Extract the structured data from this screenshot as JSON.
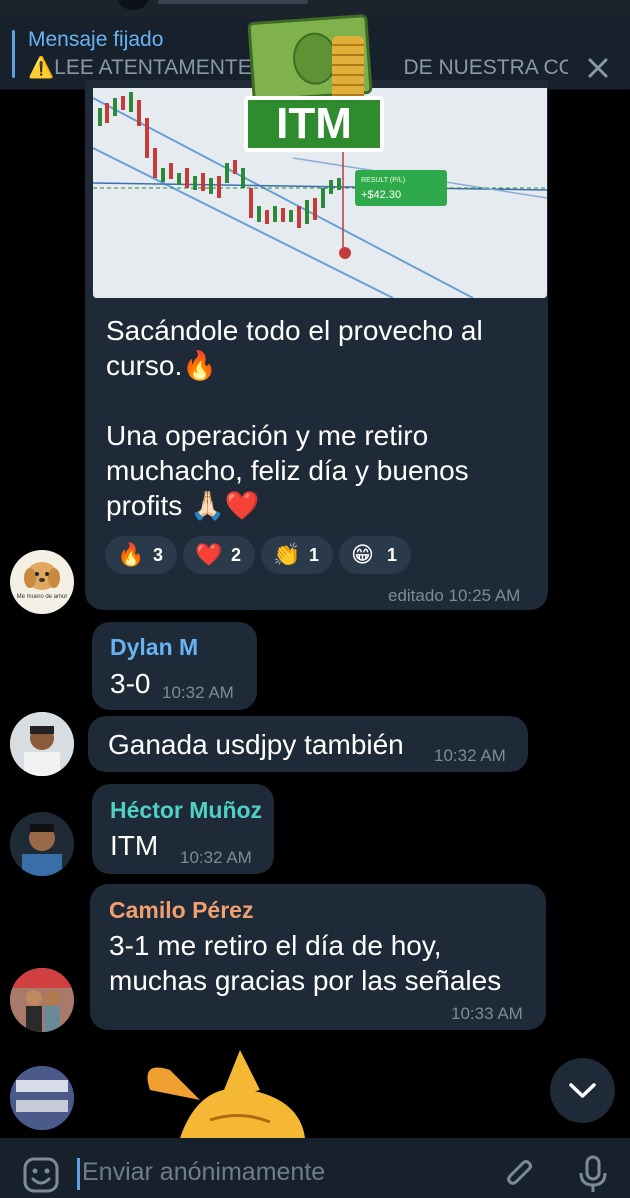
{
  "pinned": {
    "title": "Mensaje fijado",
    "text": "⚠️LEE ATENTAMENTE",
    "text_tail": "DE NUESTRA CO..."
  },
  "sticker_top": {
    "label": "ITM"
  },
  "photo_overlay": {
    "result_title": "RESULT (P/L)",
    "result_value": "+$42.30"
  },
  "messages": [
    {
      "text_line1": "Sacándole todo el provecho al",
      "text_line2": "curso.🔥",
      "text_line3": "Una operación y me retiro",
      "text_line4": "muchacho, feliz día y buenos",
      "text_line5": "profits 🙏🏻❤️",
      "reactions": [
        {
          "emoji": "🔥",
          "count": "3"
        },
        {
          "emoji": "❤️",
          "count": "2"
        },
        {
          "emoji": "👏",
          "count": "1"
        },
        {
          "emoji": "😁",
          "count": "1"
        }
      ],
      "time": "editado 10:25 AM",
      "avatar_caption": "Me muero de amor"
    },
    {
      "sender": "Dylan M",
      "sender_color": "#6ab3f3",
      "text": "3-0",
      "time": "10:32 AM"
    },
    {
      "text": "Ganada usdjpy también",
      "time": "10:32 AM"
    },
    {
      "sender": "Héctor Muñoz",
      "sender_color": "#4fd1c5",
      "text": "ITM",
      "time": "10:32 AM"
    },
    {
      "sender": "Camilo Pérez",
      "sender_color": "#f0a070",
      "text_line1": "3-1 me retiro el día de hoy,",
      "text_line2": "muchas gracias por las señales",
      "time": "10:33 AM"
    }
  ],
  "input": {
    "placeholder": "Enviar anónimamente"
  },
  "icons": [
    "close-icon",
    "emoji-icon",
    "attach-icon",
    "mic-icon",
    "chevron-down-icon"
  ]
}
